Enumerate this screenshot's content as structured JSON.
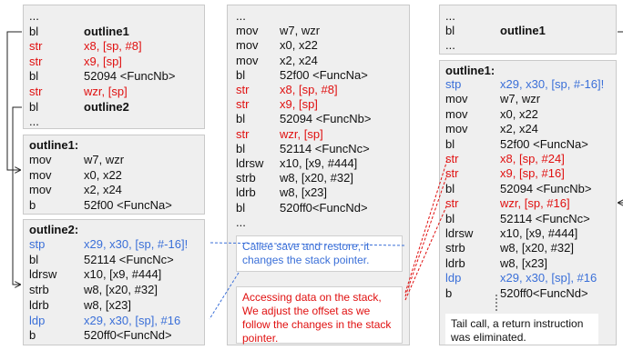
{
  "left_column": {
    "caller": {
      "rows": [
        {
          "op": "...",
          "args": "",
          "color": "black",
          "bold": false
        },
        {
          "op": "bl",
          "args": "outline1",
          "color": "black",
          "bold": true
        },
        {
          "op": "str",
          "args": "x8, [sp, #8]",
          "color": "red",
          "bold": false
        },
        {
          "op": "str",
          "args": "x9, [sp]",
          "color": "red",
          "bold": false
        },
        {
          "op": "bl",
          "args": "52094 <FuncNb>",
          "color": "black",
          "bold": false
        },
        {
          "op": "str",
          "args": "wzr, [sp]",
          "color": "red",
          "bold": false
        },
        {
          "op": "bl",
          "args": "outline2",
          "color": "black",
          "bold": true
        },
        {
          "op": "...",
          "args": "",
          "color": "black",
          "bold": false
        }
      ]
    },
    "outline1": {
      "title": "outline1:",
      "rows": [
        {
          "op": "mov",
          "args": "w7, wzr",
          "color": "black"
        },
        {
          "op": "mov",
          "args": "x0, x22",
          "color": "black"
        },
        {
          "op": "mov",
          "args": "x2, x24",
          "color": "black"
        },
        {
          "op": "b",
          "args": "52f00 <FuncNa>",
          "color": "black"
        }
      ]
    },
    "outline2": {
      "title": "outline2:",
      "rows": [
        {
          "op": "stp",
          "args": "x29, x30, [sp, #-16]!",
          "color": "blue"
        },
        {
          "op": "bl",
          "args": "52114 <FuncNc>",
          "color": "black"
        },
        {
          "op": "ldrsw",
          "args": "x10, [x9, #444]",
          "color": "black"
        },
        {
          "op": "strb",
          "args": "w8, [x20, #32]",
          "color": "black"
        },
        {
          "op": "ldrb",
          "args": "w8, [x23]",
          "color": "black"
        },
        {
          "op": "ldp",
          "args": "x29, x30, [sp], #16",
          "color": "blue"
        },
        {
          "op": "b",
          "args": "520ff0<FuncNd>",
          "color": "black"
        }
      ]
    }
  },
  "middle_column": {
    "rows": [
      {
        "op": "...",
        "args": "",
        "color": "black"
      },
      {
        "op": "mov",
        "args": "w7, wzr",
        "color": "black"
      },
      {
        "op": "mov",
        "args": "x0, x22",
        "color": "black"
      },
      {
        "op": "mov",
        "args": "x2, x24",
        "color": "black"
      },
      {
        "op": "bl",
        "args": "52f00 <FuncNa>",
        "color": "black"
      },
      {
        "op": "str",
        "args": "x8, [sp, #8]",
        "color": "red"
      },
      {
        "op": "str",
        "args": "x9, [sp]",
        "color": "red"
      },
      {
        "op": "bl",
        "args": "52094 <FuncNb>",
        "color": "black"
      },
      {
        "op": "str",
        "args": "wzr, [sp]",
        "color": "red"
      },
      {
        "op": "bl",
        "args": "52114 <FuncNc>",
        "color": "black"
      },
      {
        "op": "ldrsw",
        "args": "x10, [x9, #444]",
        "color": "black"
      },
      {
        "op": "strb",
        "args": "w8, [x20, #32]",
        "color": "black"
      },
      {
        "op": "ldrb",
        "args": "w8, [x23]",
        "color": "black"
      },
      {
        "op": "bl",
        "args": "520ff0<FuncNd>",
        "color": "black"
      },
      {
        "op": "...",
        "args": "",
        "color": "black"
      }
    ],
    "note_callee": "Callee save and restore, it changes the stack pointer.",
    "note_stack": "Accessing data on the stack, We adjust the offset as we follow the changes in the stack pointer."
  },
  "right_column": {
    "caller": {
      "rows": [
        {
          "op": "...",
          "args": "",
          "color": "black",
          "bold": false
        },
        {
          "op": "bl",
          "args": "outline1",
          "color": "black",
          "bold": true
        },
        {
          "op": "...",
          "args": "",
          "color": "black",
          "bold": false
        }
      ]
    },
    "outline1": {
      "title": "outline1:",
      "rows": [
        {
          "op": "stp",
          "args": "x29, x30, [sp, #-16]!",
          "color": "blue"
        },
        {
          "op": "mov",
          "args": "w7, wzr",
          "color": "black"
        },
        {
          "op": "mov",
          "args": "x0, x22",
          "color": "black"
        },
        {
          "op": "mov",
          "args": "x2, x24",
          "color": "black"
        },
        {
          "op": "bl",
          "args": "52f00 <FuncNa>",
          "color": "black"
        },
        {
          "op": "str",
          "args": "x8, [sp, #24]",
          "color": "red"
        },
        {
          "op": "str",
          "args": "x9, [sp, #16]",
          "color": "red"
        },
        {
          "op": "bl",
          "args": "52094 <FuncNb>",
          "color": "black"
        },
        {
          "op": "str",
          "args": "wzr, [sp, #16]",
          "color": "red"
        },
        {
          "op": "bl",
          "args": "52114 <FuncNc>",
          "color": "black"
        },
        {
          "op": "ldrsw",
          "args": "x10, [x9, #444]",
          "color": "black"
        },
        {
          "op": "strb",
          "args": "w8, [x20, #32]",
          "color": "black"
        },
        {
          "op": "ldrb",
          "args": "w8, [x23]",
          "color": "black"
        },
        {
          "op": "ldp",
          "args": "x29, x30, [sp], #16",
          "color": "blue"
        },
        {
          "op": "b",
          "args": "520ff0<FuncNd>",
          "color": "black"
        }
      ]
    },
    "note_tail": "Tail call, a return instruction was eliminated."
  },
  "colors": {
    "red": "#e01010",
    "blue": "#3a6fd8",
    "black": "#111111",
    "panel": "#efefef"
  }
}
